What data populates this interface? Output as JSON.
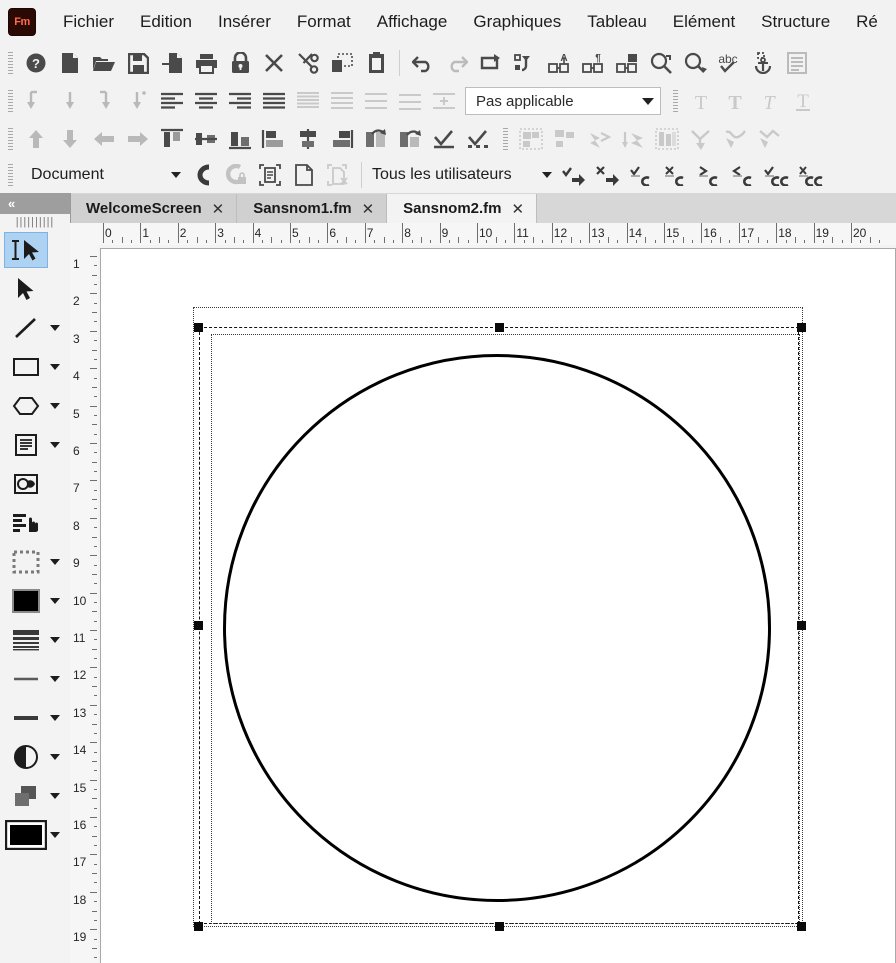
{
  "app": {
    "name": "Adobe FrameMaker",
    "logo_text": "Fm",
    "logo_color": "#ff6a4d"
  },
  "menubar": {
    "items": [
      {
        "label": "Fichier",
        "name": "menu-fichier"
      },
      {
        "label": "Edition",
        "name": "menu-edition"
      },
      {
        "label": "Insérer",
        "name": "menu-inserer"
      },
      {
        "label": "Format",
        "name": "menu-format"
      },
      {
        "label": "Affichage",
        "name": "menu-affichage"
      },
      {
        "label": "Graphiques",
        "name": "menu-graphiques"
      },
      {
        "label": "Tableau",
        "name": "menu-tableau"
      },
      {
        "label": "Elément",
        "name": "menu-element"
      },
      {
        "label": "Structure",
        "name": "menu-structure"
      },
      {
        "label": "Ré",
        "name": "menu-reviser"
      }
    ]
  },
  "toolbar_row1": {
    "icons": [
      {
        "name": "help-icon",
        "glyph": "help"
      },
      {
        "name": "new-document-icon",
        "glyph": "page"
      },
      {
        "name": "open-folder-icon",
        "glyph": "folder"
      },
      {
        "name": "save-icon",
        "glyph": "floppy"
      },
      {
        "name": "save-as-icon",
        "glyph": "page-arrow"
      },
      {
        "name": "print-icon",
        "glyph": "printer"
      },
      {
        "name": "lock-icon",
        "glyph": "lock"
      },
      {
        "name": "close-icon",
        "glyph": "x"
      },
      {
        "name": "cut-scissors-icon",
        "glyph": "scissors"
      },
      {
        "name": "copy-icon",
        "glyph": "copy"
      },
      {
        "name": "paste-icon",
        "glyph": "clipboard"
      },
      {
        "name": "undo-icon",
        "glyph": "undo"
      },
      {
        "name": "redo-icon",
        "glyph": "redo"
      },
      {
        "name": "repeat-icon",
        "glyph": "repeat"
      },
      {
        "name": "refresh-list-icon",
        "glyph": "refresh-list"
      },
      {
        "name": "find-character-format-icon",
        "glyph": "tag-a"
      },
      {
        "name": "find-paragraph-format-icon",
        "glyph": "tag-pilcrow"
      },
      {
        "name": "find-table-format-icon",
        "glyph": "tag-table"
      },
      {
        "name": "find-previous-icon",
        "glyph": "zoom-prev"
      },
      {
        "name": "find-next-icon",
        "glyph": "zoom-next"
      },
      {
        "name": "spellcheck-icon",
        "glyph": "abc-check"
      },
      {
        "name": "anchored-frame-icon",
        "glyph": "anchor"
      },
      {
        "name": "text-frame-icon",
        "glyph": "text-frame"
      }
    ]
  },
  "toolbar_row2": {
    "icons": [
      {
        "name": "indent-first-line-icon",
        "glyph": "arrow-down-hook"
      },
      {
        "name": "indent-left-icon",
        "glyph": "arrow-down"
      },
      {
        "name": "indent-right-icon",
        "glyph": "arrow-down-hook-r"
      },
      {
        "name": "indent-both-icon",
        "glyph": "arrow-down-dot"
      },
      {
        "name": "align-left-icon",
        "glyph": "align-left"
      },
      {
        "name": "align-center-icon",
        "glyph": "align-center"
      },
      {
        "name": "align-right-icon",
        "glyph": "align-right"
      },
      {
        "name": "align-justify-icon",
        "glyph": "align-justify"
      },
      {
        "name": "line-spacing-single-icon",
        "glyph": "lines-tight"
      },
      {
        "name": "line-spacing-onehalf-icon",
        "glyph": "lines-mid"
      },
      {
        "name": "line-spacing-double-icon",
        "glyph": "lines-wide"
      },
      {
        "name": "line-spacing-custom-icon",
        "glyph": "lines-wide2"
      },
      {
        "name": "space-above-icon",
        "glyph": "lines-plus"
      }
    ],
    "paragraph_format_combo": {
      "name": "paragraph-format-combo",
      "value": "Pas applicable"
    },
    "text_icons": [
      {
        "name": "plain-text-icon",
        "glyph": "T"
      },
      {
        "name": "bold-text-icon",
        "glyph": "T-bold"
      },
      {
        "name": "italic-text-icon",
        "glyph": "T-italic"
      },
      {
        "name": "underline-text-icon",
        "glyph": "T-underline"
      }
    ]
  },
  "toolbar_row3": {
    "icons": [
      {
        "name": "move-up-icon",
        "glyph": "arrow-up"
      },
      {
        "name": "move-down-icon",
        "glyph": "arrow-down"
      },
      {
        "name": "move-left-icon",
        "glyph": "arrow-left"
      },
      {
        "name": "move-right-icon",
        "glyph": "arrow-right"
      },
      {
        "name": "align-top-icon",
        "glyph": "al-top"
      },
      {
        "name": "align-middle-icon",
        "glyph": "al-middle"
      },
      {
        "name": "align-bottom-icon",
        "glyph": "al-bottom"
      },
      {
        "name": "align-objects-left-icon",
        "glyph": "ob-left"
      },
      {
        "name": "align-objects-center-icon",
        "glyph": "ob-center"
      },
      {
        "name": "align-objects-right-icon",
        "glyph": "ob-right"
      },
      {
        "name": "rotate-object-icon",
        "glyph": "rotate"
      },
      {
        "name": "flip-object-icon",
        "glyph": "flip"
      },
      {
        "name": "check-spelling-doc-icon",
        "glyph": "check"
      },
      {
        "name": "check-spelling-all-icon",
        "glyph": "check-dots"
      },
      {
        "name": "group-objects-icon",
        "glyph": "group"
      },
      {
        "name": "ungroup-objects-icon",
        "glyph": "ungroup"
      },
      {
        "name": "bring-to-front-icon",
        "glyph": "front"
      },
      {
        "name": "send-to-back-icon",
        "glyph": "back"
      },
      {
        "name": "distribute-objects-icon",
        "glyph": "distribute"
      },
      {
        "name": "join-paths-icon",
        "glyph": "join"
      },
      {
        "name": "smooth-path-icon",
        "glyph": "smooth"
      },
      {
        "name": "unsmooth-path-icon",
        "glyph": "unsmooth"
      }
    ]
  },
  "toolbar_row4": {
    "view_combo": {
      "name": "view-mode-combo",
      "value": "Document"
    },
    "left_icons": [
      {
        "name": "structure-view-icon",
        "glyph": "element"
      },
      {
        "name": "structure-locked-icon",
        "glyph": "element-lock"
      },
      {
        "name": "validate-document-icon",
        "glyph": "doc-valid"
      },
      {
        "name": "new-structured-doc-icon",
        "glyph": "doc-plain"
      },
      {
        "name": "invalid-document-icon",
        "glyph": "doc-invalid"
      }
    ],
    "user_combo": {
      "name": "conditional-user-combo",
      "value": "Tous les utilisateurs"
    },
    "right_icons": [
      {
        "name": "accept-change-icon",
        "glyph": "check-arrow"
      },
      {
        "name": "reject-change-icon",
        "glyph": "x-arrow"
      },
      {
        "name": "accept-element-icon",
        "glyph": "check-elem"
      },
      {
        "name": "reject-element-icon",
        "glyph": "x-elem"
      },
      {
        "name": "next-change-icon",
        "glyph": "gt-elem"
      },
      {
        "name": "previous-change-icon",
        "glyph": "lt-elem"
      },
      {
        "name": "accept-all-icon",
        "glyph": "check-elem2"
      },
      {
        "name": "reject-all-icon",
        "glyph": "x-elem2"
      }
    ]
  },
  "tabs": [
    {
      "name": "tab-welcomescreen",
      "label": "WelcomeScreen",
      "close": "✕",
      "active": false
    },
    {
      "name": "tab-sansnom1",
      "label": "Sansnom1.fm",
      "close": "✕",
      "active": false
    },
    {
      "name": "tab-sansnom2",
      "label": "Sansnom2.fm",
      "close": "✕",
      "active": true
    }
  ],
  "tool_palette": {
    "collapse_label": "«",
    "tools": [
      {
        "name": "tool-smart-select",
        "glyph": "smart-select",
        "selected": true,
        "caret": false
      },
      {
        "name": "tool-object-select",
        "glyph": "arrow-select",
        "selected": false,
        "caret": false
      },
      {
        "name": "tool-line",
        "glyph": "line",
        "selected": false,
        "caret": true
      },
      {
        "name": "tool-rectangle",
        "glyph": "rect",
        "selected": false,
        "caret": true
      },
      {
        "name": "tool-polygon",
        "glyph": "polygon",
        "selected": false,
        "caret": true
      },
      {
        "name": "tool-text-frame",
        "glyph": "text-frame",
        "selected": false,
        "caret": true
      },
      {
        "name": "tool-image",
        "glyph": "image",
        "selected": false,
        "caret": false
      },
      {
        "name": "tool-hotspot",
        "glyph": "hotspot",
        "selected": false,
        "caret": false
      },
      {
        "name": "tool-select-area",
        "glyph": "marquee",
        "selected": false,
        "caret": true
      },
      {
        "name": "tool-fill-color",
        "glyph": "swatch-black",
        "selected": false,
        "caret": true
      },
      {
        "name": "tool-fill-pattern",
        "glyph": "pattern",
        "selected": false,
        "caret": true
      },
      {
        "name": "tool-line-width",
        "glyph": "line-thin",
        "selected": false,
        "caret": true
      },
      {
        "name": "tool-line-style",
        "glyph": "line-thick",
        "selected": false,
        "caret": true
      },
      {
        "name": "tool-tint",
        "glyph": "tint",
        "selected": false,
        "caret": true
      },
      {
        "name": "tool-overprint",
        "glyph": "overlap",
        "selected": false,
        "caret": true
      },
      {
        "name": "tool-color",
        "glyph": "swatch-framed",
        "selected": false,
        "caret": true
      }
    ]
  },
  "rulers": {
    "horizontal": {
      "name": "horizontal-ruler",
      "unit": "cm",
      "labels": [
        "0",
        "1",
        "2",
        "3",
        "4",
        "5",
        "6",
        "7",
        "8",
        "9",
        "10",
        "11",
        "12",
        "13",
        "14",
        "15",
        "16",
        "17",
        "18",
        "19",
        "20"
      ]
    },
    "vertical": {
      "name": "vertical-ruler",
      "unit": "cm",
      "labels": [
        "1",
        "2",
        "3",
        "4",
        "5",
        "6",
        "7",
        "8",
        "9",
        "10",
        "11",
        "12",
        "13",
        "14",
        "15",
        "16",
        "17",
        "18",
        "19"
      ]
    }
  },
  "canvas": {
    "name": "document-canvas",
    "text_frame": {
      "name": "text-frame-outline"
    },
    "selection": {
      "name": "selected-object-bounds",
      "handle_count": 8
    },
    "shape": {
      "name": "ellipse-shape",
      "type": "circle"
    }
  }
}
